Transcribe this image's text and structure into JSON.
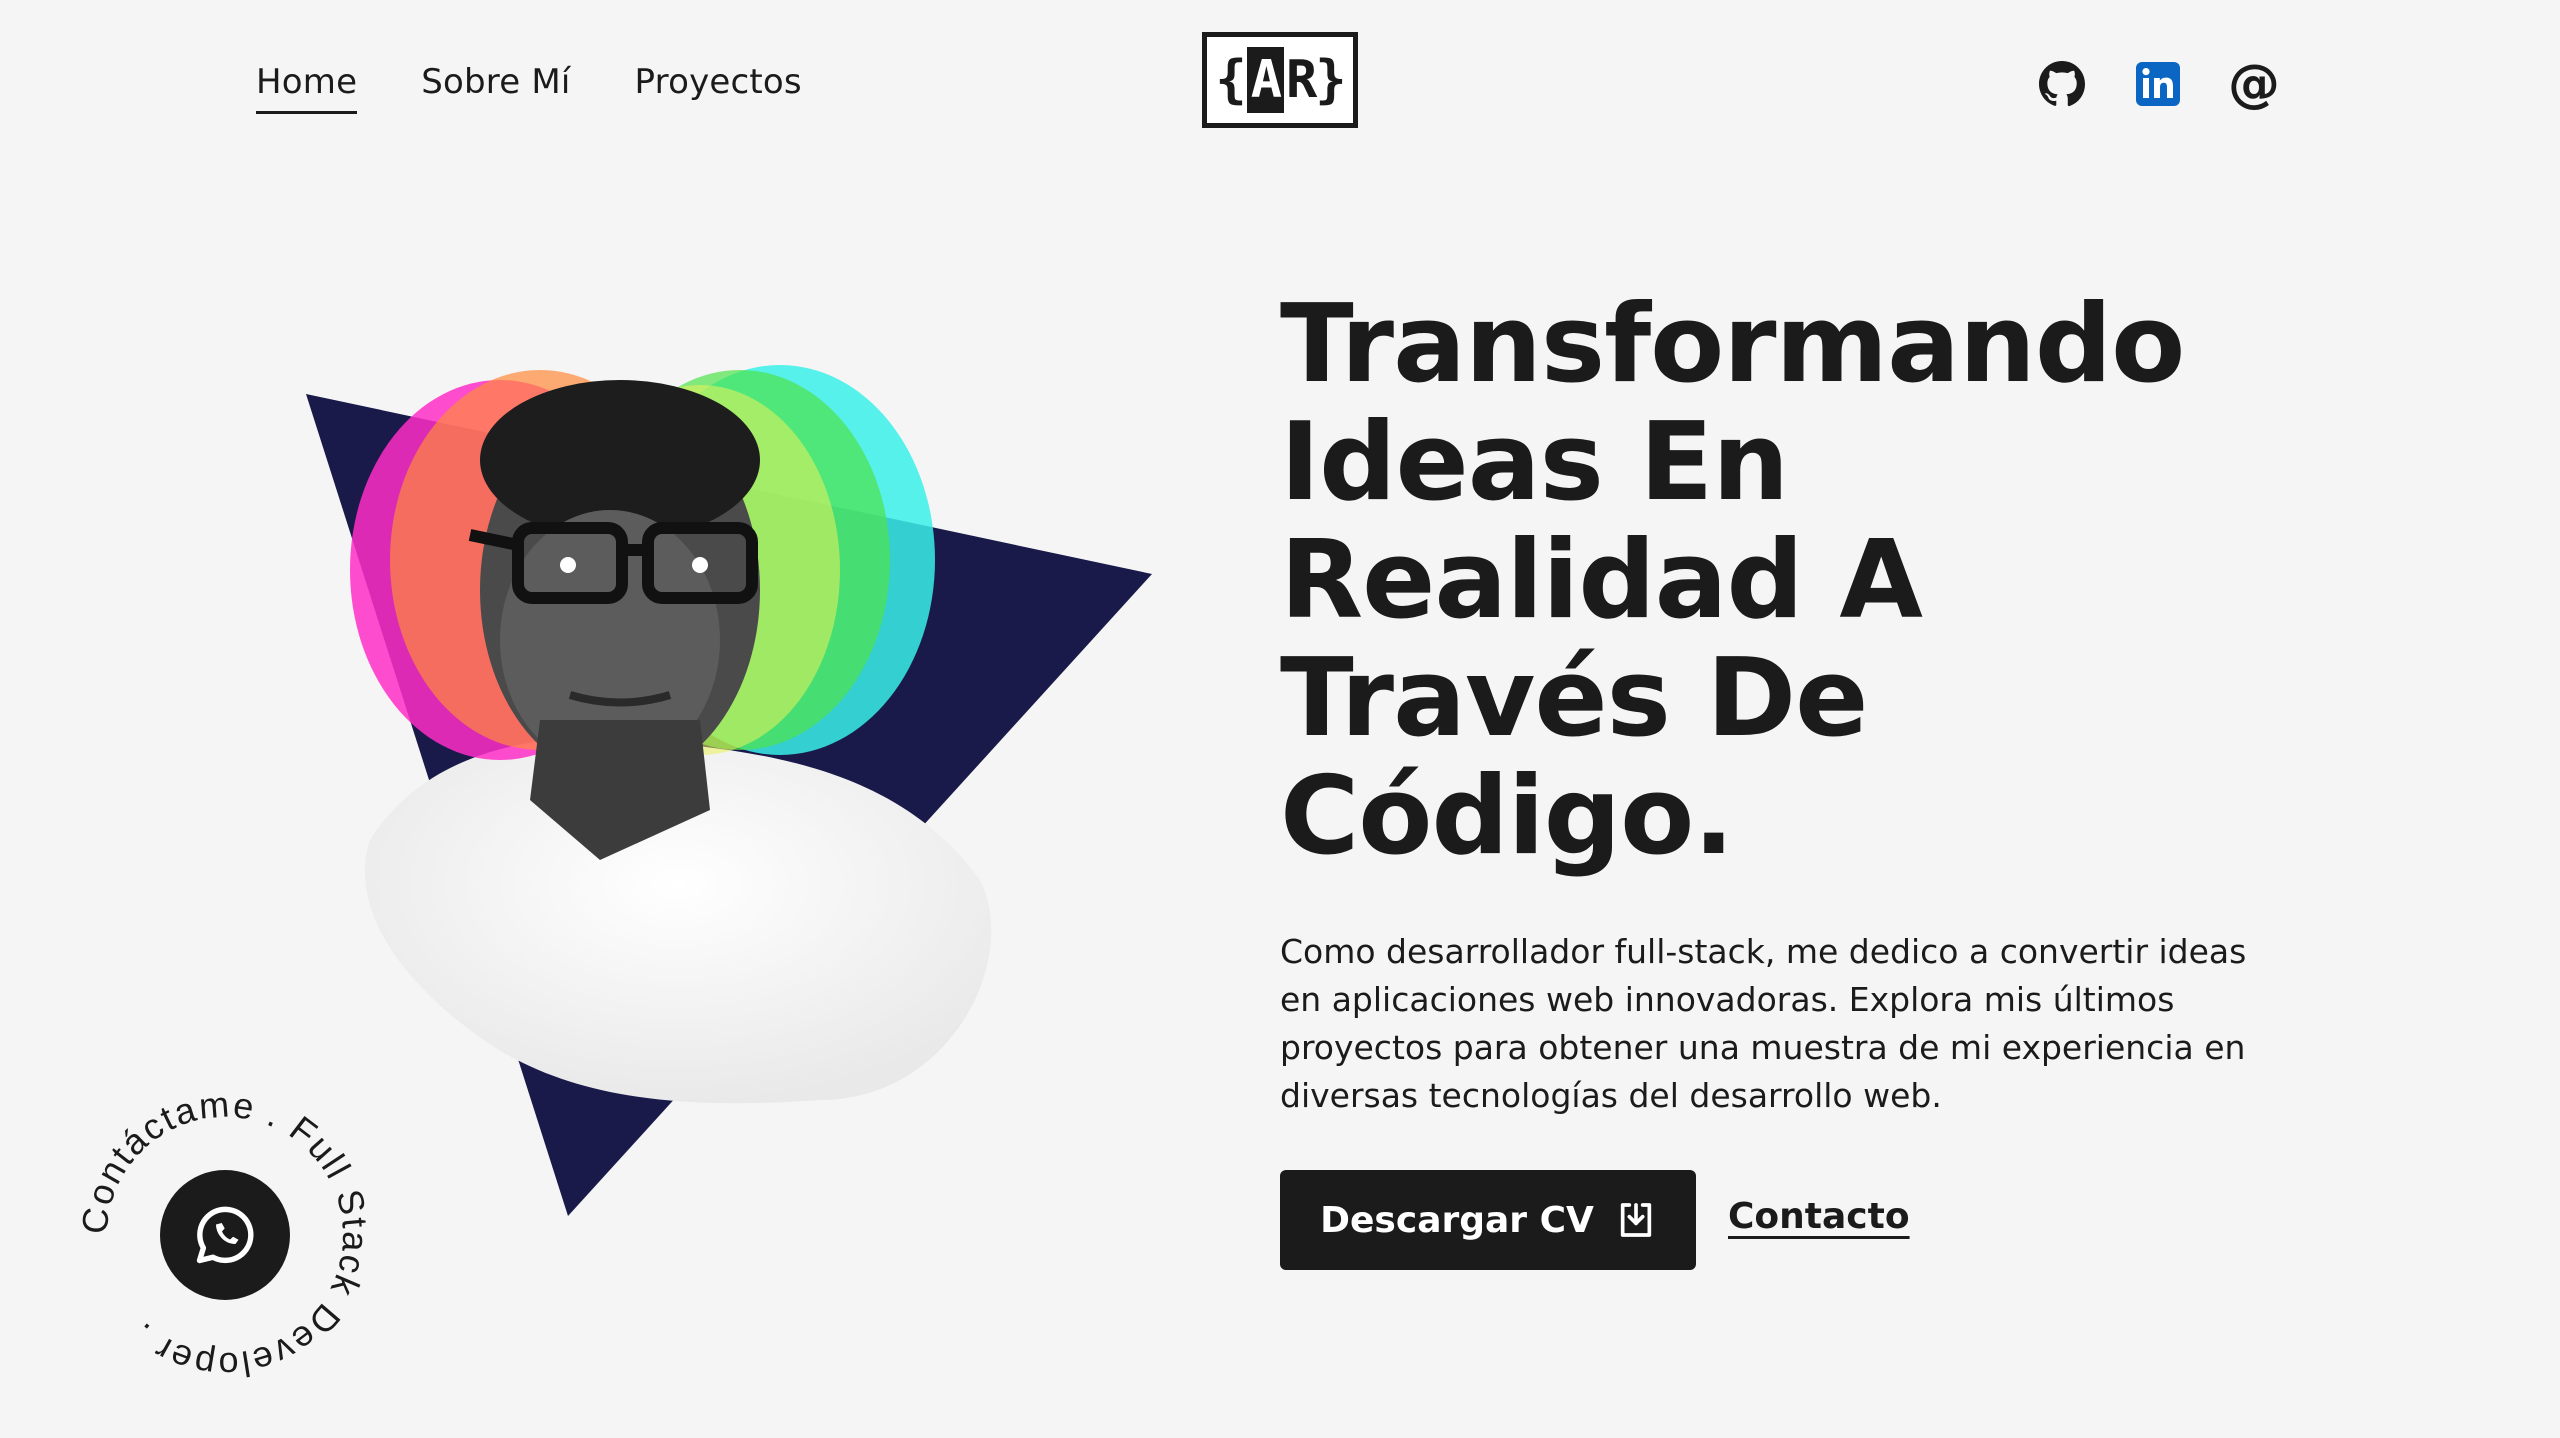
{
  "nav": {
    "items": [
      {
        "label": "Home",
        "active": true
      },
      {
        "label": "Sobre Mí",
        "active": false
      },
      {
        "label": "Proyectos",
        "active": false
      }
    ]
  },
  "logo": {
    "left": "{",
    "mark": "A",
    "right": "R}"
  },
  "socials": [
    {
      "icon": "github-icon"
    },
    {
      "icon": "linkedin-icon",
      "color": "#0a66c2"
    },
    {
      "icon": "at-icon",
      "glyph": "@"
    }
  ],
  "hero": {
    "headline_lines": [
      "Transformando",
      "Ideas En",
      "Realidad A",
      "Través De",
      "Código."
    ],
    "description": "Como desarrollador full-stack, me dedico a convertir ideas en aplicaciones web innovadoras. Explora mis últimos proyectos para obtener una muestra de mi experiencia en diversas tecnologías del desarrollo web.",
    "cv_button": "Descargar CV",
    "contact_link": "Contacto"
  },
  "badge": {
    "ring_text": "Contáctame . Full Stack Developer . ",
    "icon": "whatsapp-icon"
  },
  "colors": {
    "background": "#f5f5f5",
    "text": "#1b1b1b",
    "triangle": "#1a1a4a"
  }
}
